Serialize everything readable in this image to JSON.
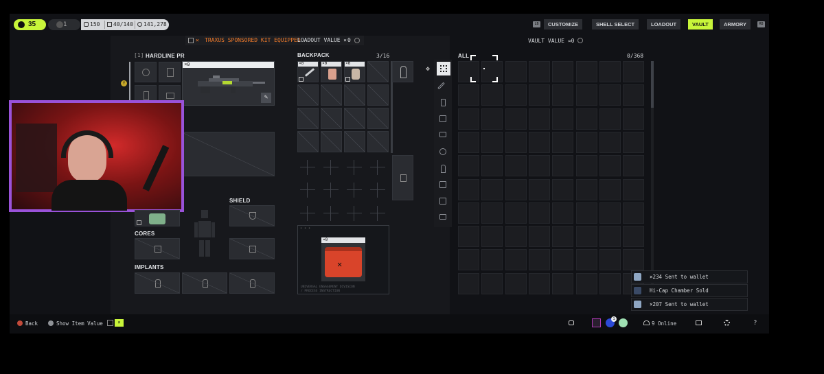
{
  "top_bar": {
    "level": "35",
    "rank_value": "1",
    "currency1": "150",
    "capacity": "40/140",
    "credits": "141,278",
    "nav": [
      {
        "label": "CUSTOMIZE",
        "active": false
      },
      {
        "label": "SHELL SELECT",
        "active": false
      },
      {
        "label": "LOADOUT",
        "active": false
      },
      {
        "label": "VAULT",
        "active": true
      },
      {
        "label": "ARMORY",
        "active": false
      }
    ],
    "lb_hint": "LB",
    "rb_hint": "RB"
  },
  "loadout": {
    "sponsor_text": "TRAXUS SPONSORED KIT EQUIPPED",
    "value_label": "LOADOUT VALUE",
    "value": "0",
    "weapon_slot_index": "[1]",
    "weapon_name": "HARDLINE PR",
    "weapon_value": "0",
    "shield_label": "SHIELD",
    "cores_label": "CORES",
    "implants_label": "IMPLANTS"
  },
  "backpack": {
    "label": "BACKPACK",
    "count": "3/16",
    "item_values": [
      "0",
      "0",
      "0"
    ],
    "kit_value": "0",
    "kit_footer_line1": "UNIVERSAL ENGAGEMENT DIVISION",
    "kit_footer_line2": "/ PROCESS INSTRUCTION"
  },
  "vault": {
    "filter_label": "ALL",
    "value_label": "VAULT VALUE",
    "value": "0",
    "count": "0/368"
  },
  "notifications": [
    {
      "text": "×234 Sent to wallet",
      "icon": "wallet-icon"
    },
    {
      "text": "Hi-Cap Chamber Sold",
      "icon": "mod-icon"
    },
    {
      "text": "×207 Sent to wallet",
      "icon": "wallet-icon"
    }
  ],
  "bottom_bar": {
    "back_label": "Back",
    "show_value_label": "Show Item Value",
    "online_label": "9 Online",
    "badge_count": "1"
  },
  "colors": {
    "accent": "#c8f53a",
    "sponsor": "#f07a2a",
    "kit_red": "#d9442a",
    "webcam_frame": "#9a52d9"
  }
}
